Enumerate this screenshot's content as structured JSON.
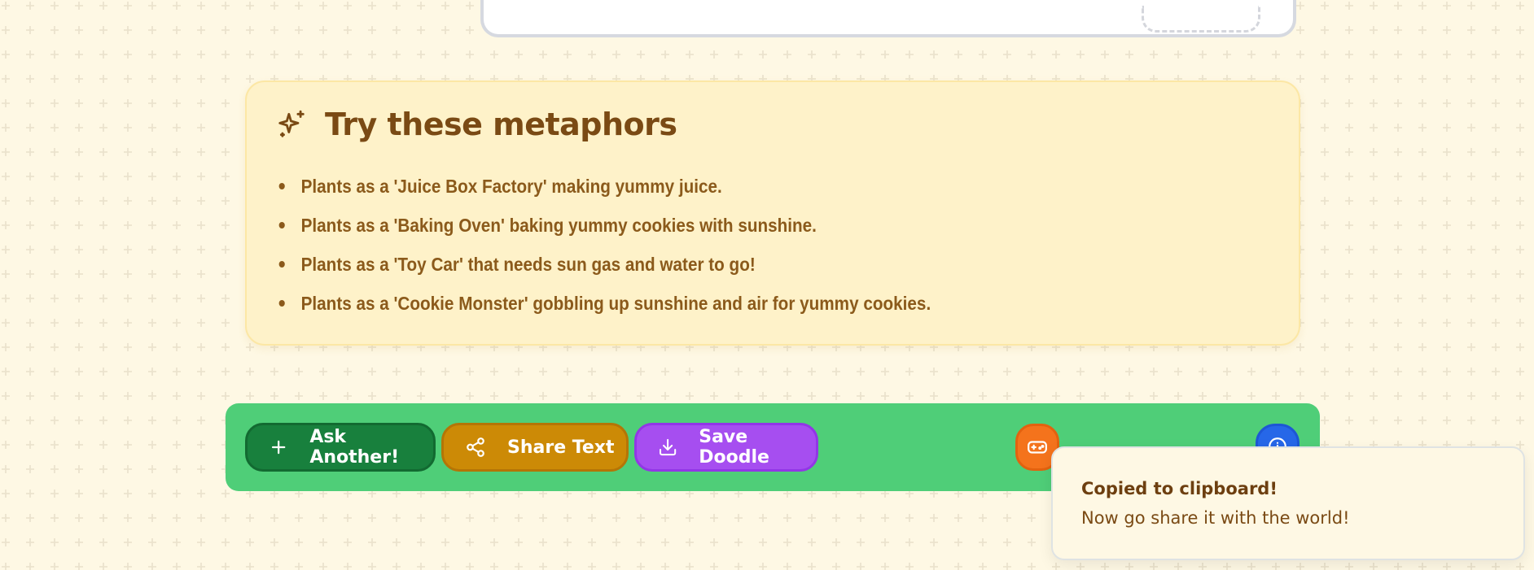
{
  "theme": {
    "background": "#fef8e4",
    "card_background": "#fef2c9",
    "text_brown": "#7a4a14",
    "action_bar_green": "#4fce78",
    "ask_green": "#18803d",
    "share_gold": "#cc8a06",
    "save_purple": "#a64ef0",
    "game_orange": "#f4731c",
    "info_blue": "#2667e8"
  },
  "metaphors": {
    "icon": "sparkles-icon",
    "title": "Try these metaphors",
    "items": [
      "Plants as a 'Juice Box Factory' making yummy juice.",
      "Plants as a 'Baking Oven' baking yummy cookies with sunshine.",
      "Plants as a 'Toy Car' that needs sun gas and water to go!",
      "Plants as a 'Cookie Monster' gobbling up sunshine and air for yummy cookies."
    ]
  },
  "actions": {
    "ask_label": "Ask Another!",
    "ask_icon": "plus-icon",
    "share_label": "Share Text",
    "share_icon": "share-icon",
    "save_label": "Save Doodle",
    "save_icon": "download-icon",
    "game_icon": "gamepad-icon",
    "info_icon": "info-icon"
  },
  "toast": {
    "title": "Copied to clipboard!",
    "message": "Now go share it with the world!"
  }
}
